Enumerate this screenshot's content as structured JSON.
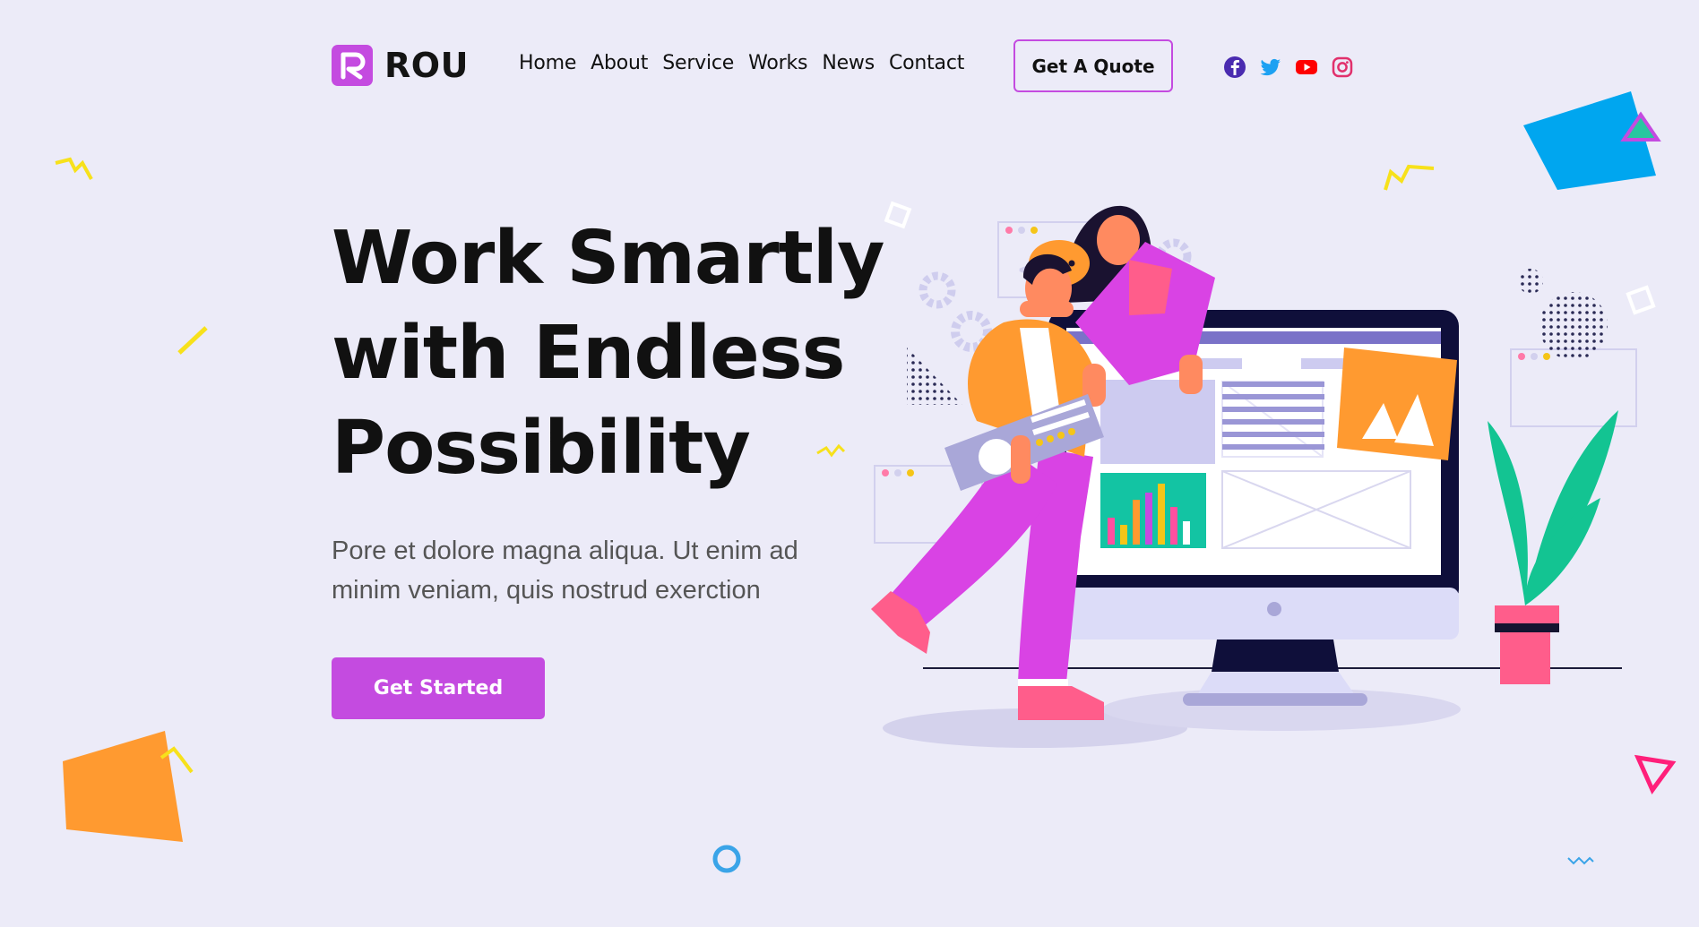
{
  "brand": {
    "name": "ROU",
    "accent": "#c44be0"
  },
  "nav": {
    "items": [
      {
        "label": "Home"
      },
      {
        "label": "About"
      },
      {
        "label": "Service"
      },
      {
        "label": "Works"
      },
      {
        "label": "News"
      },
      {
        "label": "Contact"
      }
    ]
  },
  "header": {
    "quote_label": "Get A Quote",
    "social": [
      {
        "icon": "facebook-icon",
        "color": "#4a2bb0"
      },
      {
        "icon": "twitter-icon",
        "color": "#1da1f2"
      },
      {
        "icon": "youtube-icon",
        "color": "#ff0000"
      },
      {
        "icon": "instagram-icon",
        "color": "#e1306c"
      }
    ]
  },
  "hero": {
    "title_lines": [
      "Work Smartly",
      "with Endless",
      "Possibility"
    ],
    "subtitle_lines": [
      "Pore et dolore magna aliqua. Ut enim ad",
      "minim veniam, quis nostrud exerction"
    ],
    "cta_label": "Get Started"
  },
  "colors": {
    "background": "#ecebf8",
    "orange": "#ff9a30",
    "blue": "#00a6ef",
    "yellow": "#f7e11b",
    "pink": "#ff2f8a"
  }
}
